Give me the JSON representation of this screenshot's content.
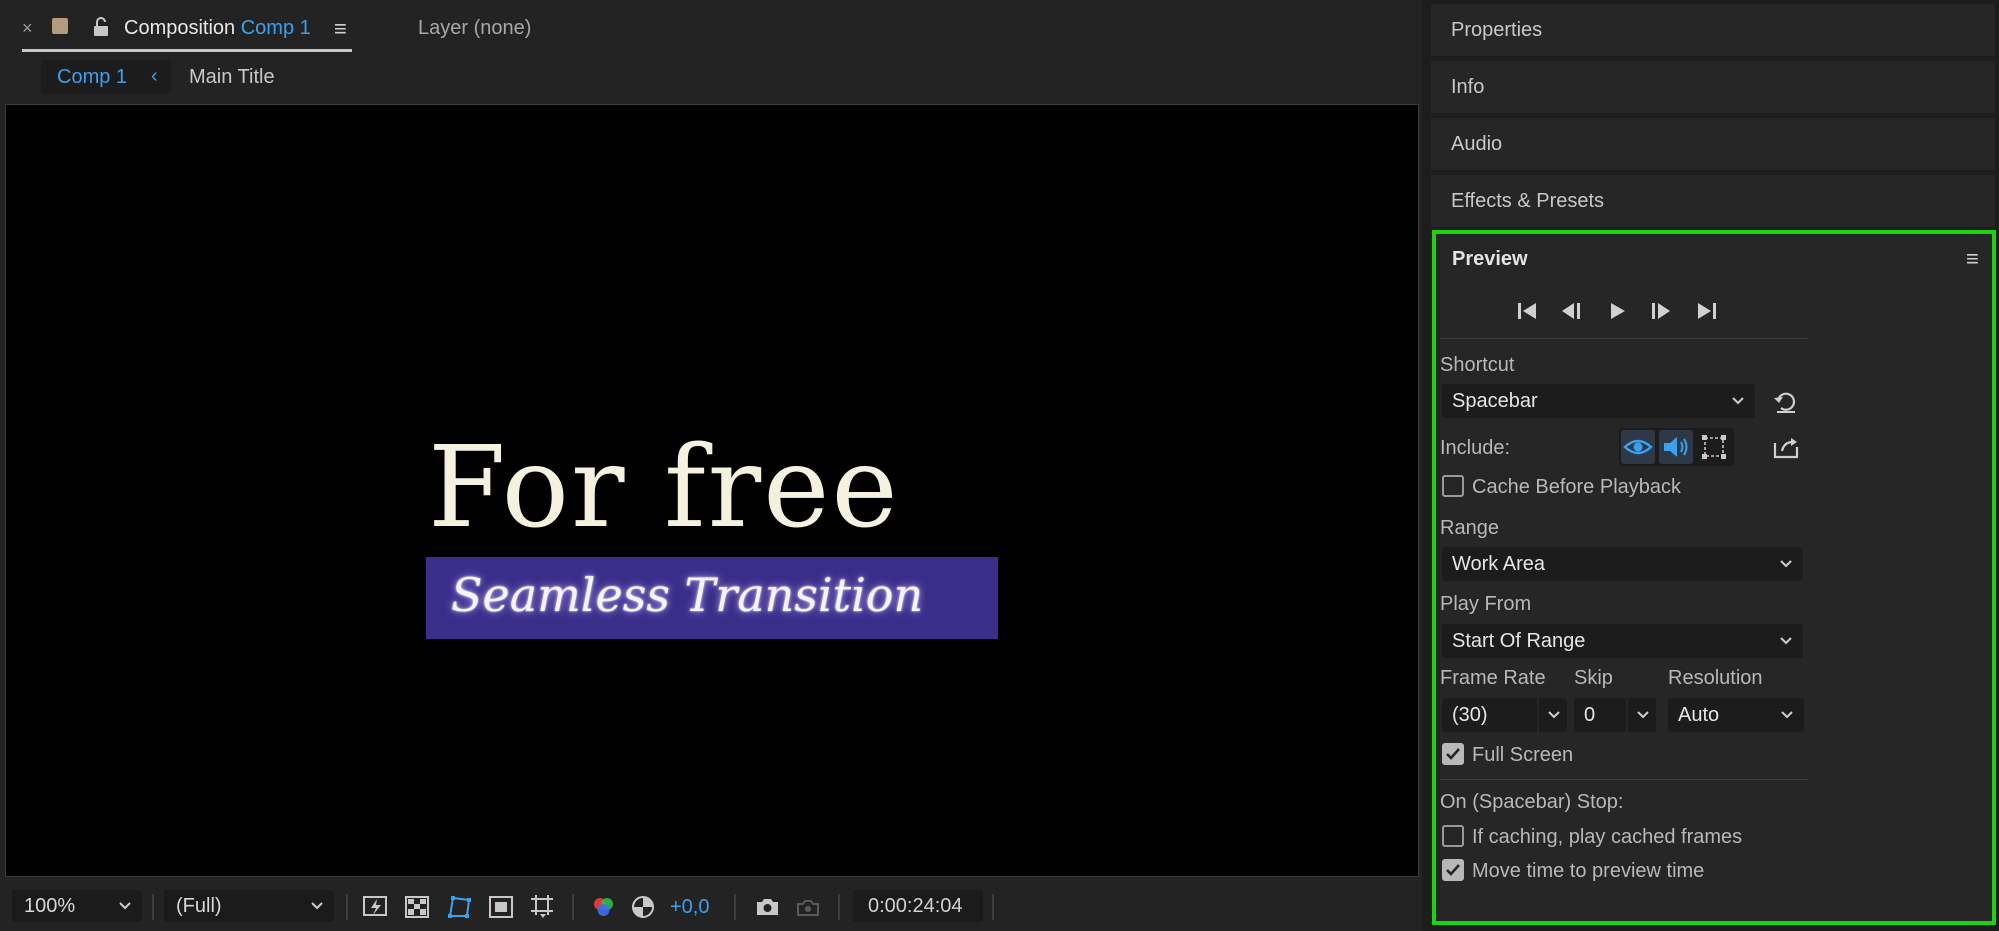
{
  "composition_tab": {
    "close": "×",
    "title_prefix": "Composition",
    "comp_name": "Comp 1",
    "menu": "≡",
    "layer_tab": "Layer (none)"
  },
  "breadcrumb": {
    "active": "Comp 1",
    "separator": "‹",
    "next": "Main Title"
  },
  "viewer": {
    "title_text": "For free",
    "subtitle_text": "Seamless Transition",
    "subtitle_bg": "#3b2e8a"
  },
  "toolbar": {
    "zoom": "100%",
    "resolution": "(Full)",
    "exposure": "+0,0",
    "timecode": "0:00:24:04",
    "accent": "#3aa0f0"
  },
  "right_panels": {
    "properties": "Properties",
    "info": "Info",
    "audio": "Audio",
    "effects": "Effects & Presets"
  },
  "preview": {
    "title": "Preview",
    "menu": "≡",
    "highlight": "#19d40f",
    "shortcut_label": "Shortcut",
    "shortcut_value": "Spacebar",
    "include_label": "Include:",
    "cache_label": "Cache Before Playback",
    "cache_checked": false,
    "range_label": "Range",
    "range_value": "Work Area",
    "play_from_label": "Play From",
    "play_from_value": "Start Of Range",
    "frame_rate_label": "Frame Rate",
    "frame_rate_value": "(30)",
    "skip_label": "Skip",
    "skip_value": "0",
    "resolution_label": "Resolution",
    "resolution_value": "Auto",
    "full_screen_label": "Full Screen",
    "full_screen_checked": true,
    "stop_label": "On (Spacebar) Stop:",
    "if_caching_label": "If caching, play cached frames",
    "if_caching_checked": false,
    "move_time_label": "Move time to preview time",
    "move_time_checked": true
  }
}
